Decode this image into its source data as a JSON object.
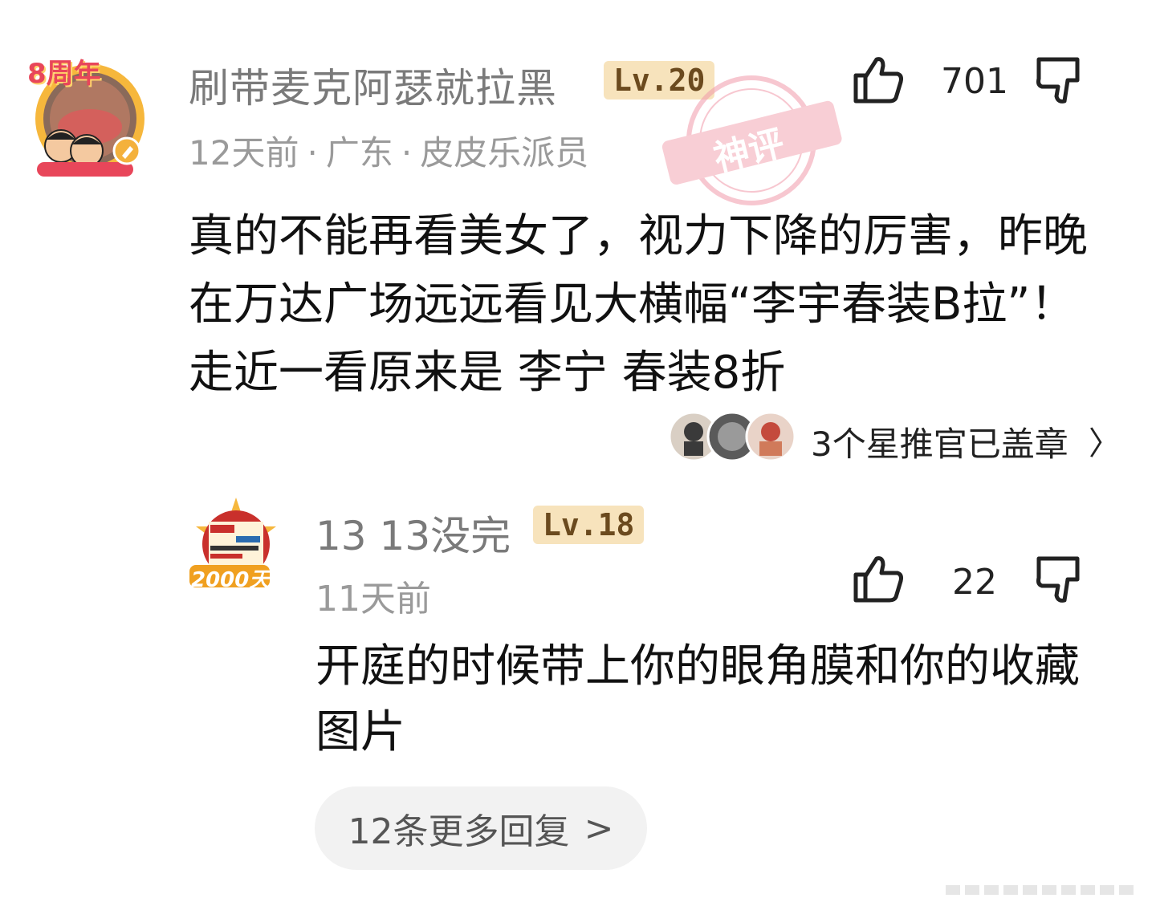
{
  "comment": {
    "username": "刷带麦克阿瑟就拉黑",
    "level": "Lv.20",
    "time": "12天前",
    "location": "广东",
    "role": "皮皮乐派员",
    "separator": "·",
    "badge_text": "神评",
    "likes": "701",
    "text": "真的不能再看美女了，视力下降的厉害，昨晚在万达广场远远看见大横幅“李宇春装B拉”！走近一看原来是 李宁 春装8折",
    "stamps": {
      "label": "3个星推官已盖章",
      "chevron": "〉",
      "count": 3
    },
    "avatar_badge_text": "8周年"
  },
  "reply": {
    "username": "13  13没完",
    "level": "Lv.18",
    "time": "11天前",
    "likes": "22",
    "text": "开庭的时候带上你的眼角膜和你的收藏图片",
    "avatar_badge_text": "2000天"
  },
  "more_replies": {
    "label": "12条更多回复",
    "chevron": ">"
  },
  "colors": {
    "username": "#7a7a7a",
    "meta": "#9a9a9a",
    "level_bg": "#f7e3bc",
    "level_text": "#6b4a1e",
    "badge": "#f4a7b4",
    "more_bg": "#f2f2f2"
  },
  "icons": [
    "thumbs-up-icon",
    "thumbs-down-icon",
    "chevron-right-icon"
  ]
}
